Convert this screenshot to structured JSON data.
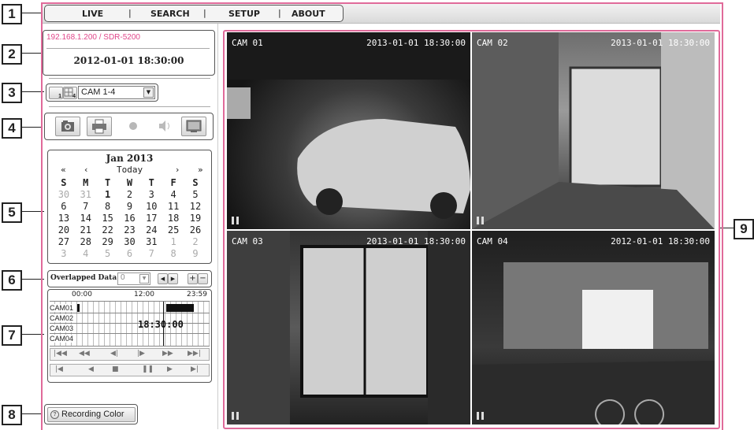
{
  "callouts": [
    "1",
    "2",
    "3",
    "4",
    "5",
    "6",
    "7",
    "8",
    "9"
  ],
  "nav": {
    "items": [
      "LIVE",
      "SEARCH",
      "SETUP",
      "ABOUT"
    ],
    "separator": "|"
  },
  "device": {
    "address": "192.168.1.200 / SDR-5200",
    "datetime": "2012-01-01 18:30:00"
  },
  "layout": {
    "single_label": "1",
    "quad_label": "4",
    "cam_select": "CAM 1-4"
  },
  "calendar": {
    "month": "Jan 2013",
    "nav": [
      "«",
      "‹",
      "Today",
      "›",
      "»"
    ],
    "weekdays": [
      "S",
      "M",
      "T",
      "W",
      "T",
      "F",
      "S"
    ],
    "weeks": [
      [
        "30",
        "31",
        "1",
        "2",
        "3",
        "4",
        "5"
      ],
      [
        "6",
        "7",
        "8",
        "9",
        "10",
        "11",
        "12"
      ],
      [
        "13",
        "14",
        "15",
        "16",
        "17",
        "18",
        "19"
      ],
      [
        "20",
        "21",
        "22",
        "23",
        "24",
        "25",
        "26"
      ],
      [
        "27",
        "28",
        "29",
        "30",
        "31",
        "1",
        "2"
      ],
      [
        "3",
        "4",
        "5",
        "6",
        "7",
        "8",
        "9"
      ]
    ],
    "selected": "1"
  },
  "overlap": {
    "label": "Overlapped Data",
    "value": "0",
    "plus": "+",
    "minus": "−"
  },
  "timeline": {
    "ticks": [
      "00:00",
      "12:00",
      "23:59"
    ],
    "cams": [
      "CAM01",
      "CAM02",
      "CAM03",
      "CAM04"
    ],
    "current_time": "18:30:00"
  },
  "recording_color": {
    "label": "Recording Color"
  },
  "cameras": [
    {
      "name": "CAM 01",
      "time": "2013-01-01 18:30:00"
    },
    {
      "name": "CAM 02",
      "time": "2013-01-01 18:30:00"
    },
    {
      "name": "CAM 03",
      "time": "2013-01-01 18:30:00"
    },
    {
      "name": "CAM 04",
      "time": "2012-01-01 18:30:00"
    }
  ],
  "colors": {
    "accent": "#e06a9a",
    "link": "#e0478a"
  }
}
